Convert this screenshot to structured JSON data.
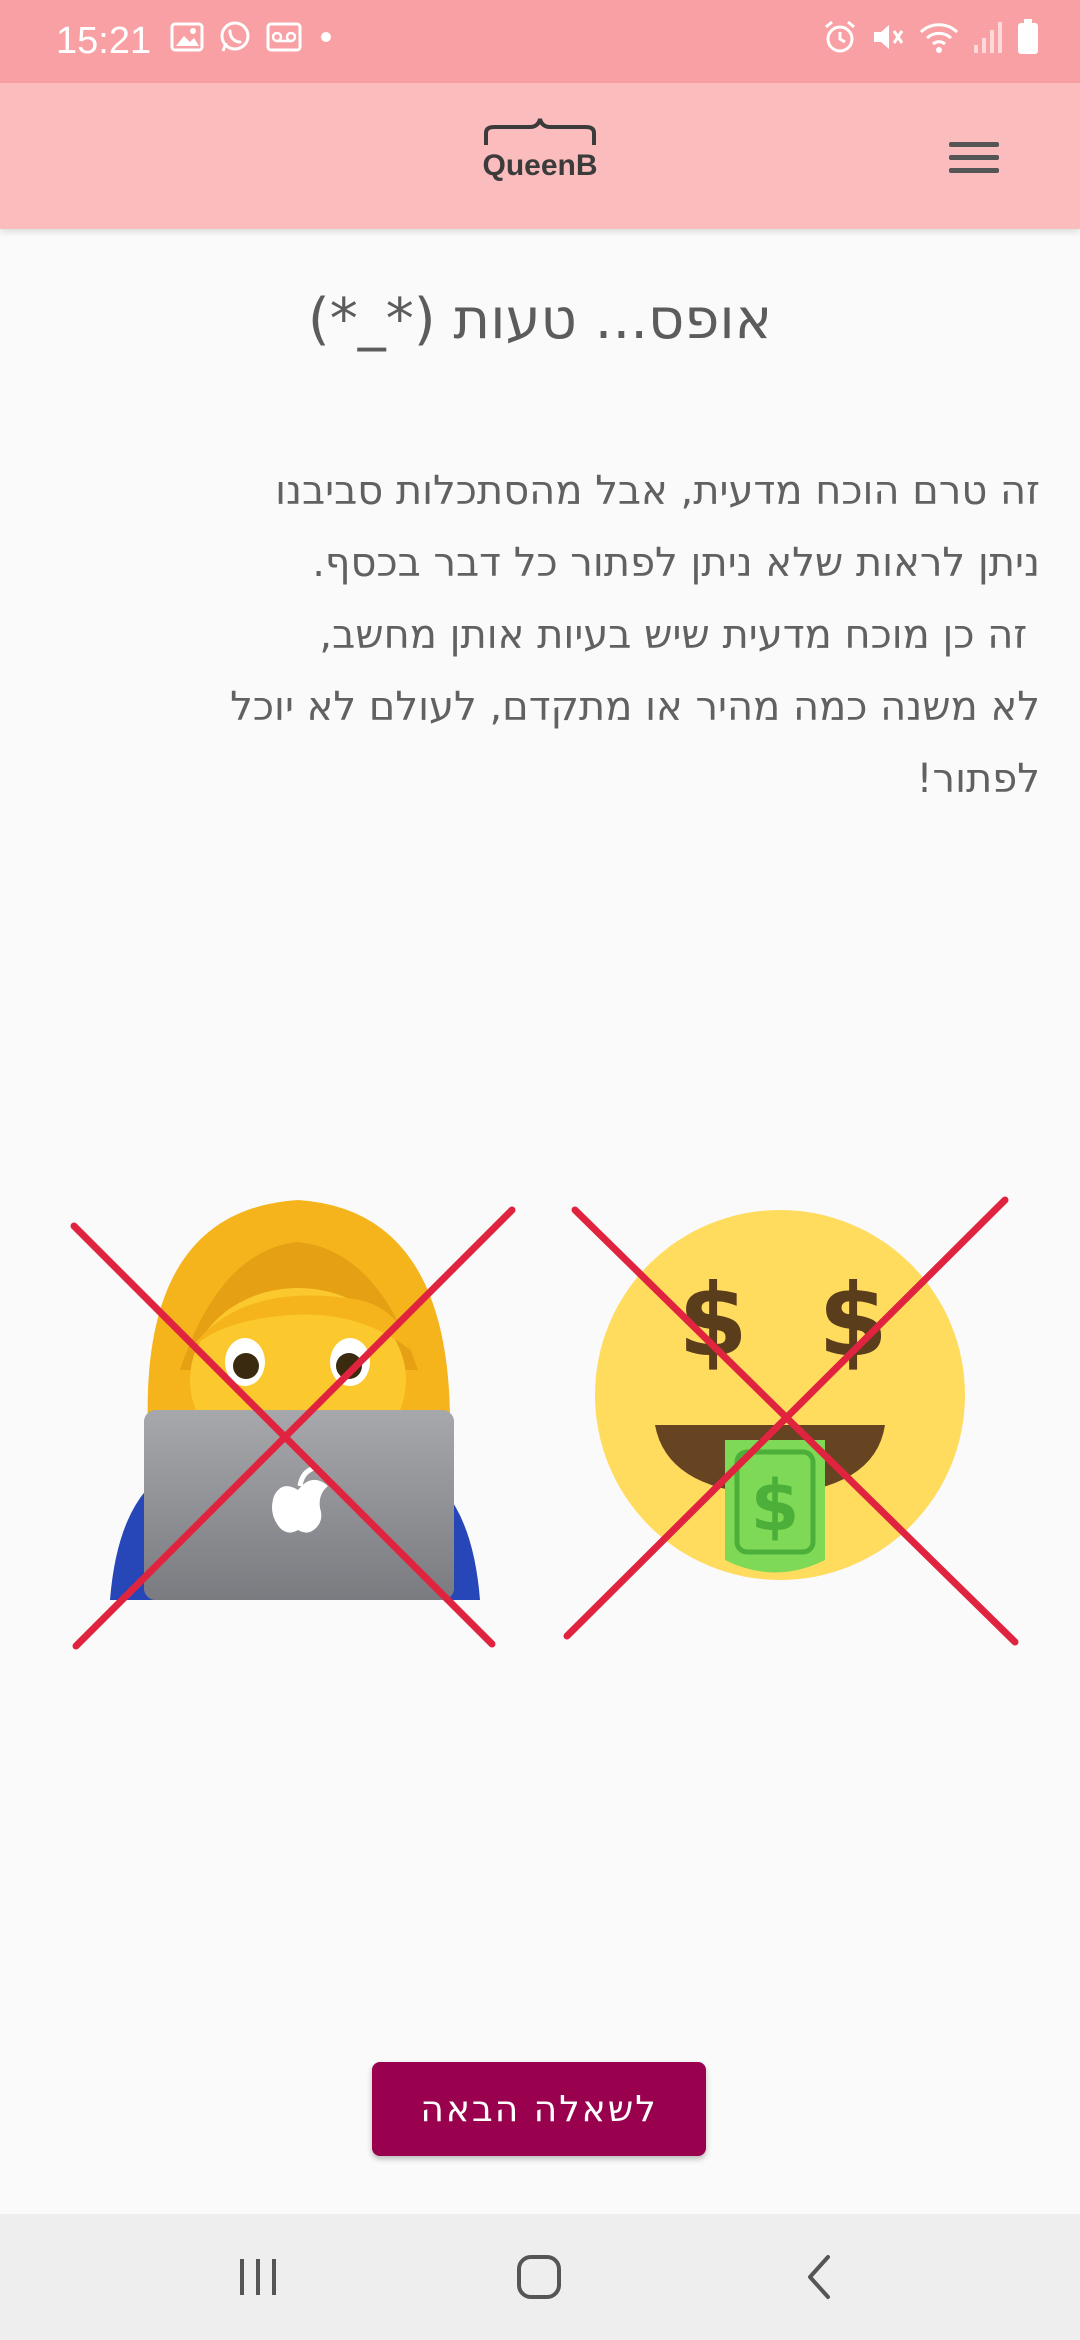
{
  "status_bar": {
    "time": "15:21",
    "left_icons": [
      "gallery-icon",
      "whatsapp-icon",
      "voicemail-icon",
      "dot-icon"
    ],
    "right_icons": [
      "alarm-icon",
      "mute-icon",
      "wifi-icon",
      "signal-icon",
      "battery-icon"
    ]
  },
  "app_bar": {
    "logo_text": "QueenB",
    "menu_icon": "hamburger-menu-icon"
  },
  "main": {
    "title": "אופס... טעות (*_*)",
    "paragraph_lines": [
      "זה טרם הוכח מדעית, אבל מהסתכלות סביבנו",
      "ניתן לראות שלא ניתן לפתור כל דבר בכסף.",
      " זה כן מוכח מדעית שיש בעיות אותן מחשב,",
      "לא משנה כמה מהיר או מתקדם, לעולם לא יוכל",
      "לפתור!"
    ],
    "images": [
      {
        "name": "woman-technologist-emoji",
        "crossed_out": true
      },
      {
        "name": "money-mouth-face-emoji",
        "crossed_out": true
      }
    ],
    "next_button_label": "לשאלה הבאה"
  },
  "nav_bar": {
    "buttons": [
      "recents-icon",
      "home-icon",
      "back-icon"
    ]
  },
  "colors": {
    "status_bar": "#f8a0a3",
    "app_bar": "#fbbcbd",
    "background": "#fafafa",
    "button": "#99004d",
    "cross": "#e0243f",
    "nav_bar": "#eeeeee"
  }
}
